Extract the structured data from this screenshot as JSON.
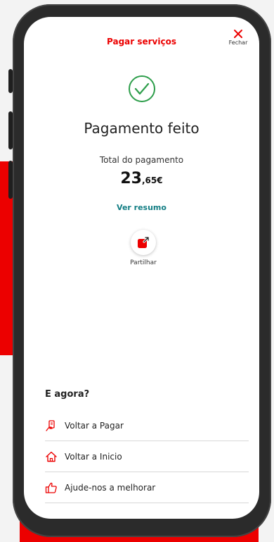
{
  "header": {
    "title": "Pagar serviços",
    "close_label": "Fechar"
  },
  "status": {
    "title": "Pagamento feito",
    "total_label": "Total do pagamento",
    "amount_integer": "23",
    "amount_decimal": ",65€",
    "summary_link": "Ver resumo"
  },
  "share": {
    "label": "Partilhar"
  },
  "next_steps": {
    "heading": "E agora?",
    "items": [
      {
        "label": "Voltar a Pagar",
        "icon": "payment-hand-icon"
      },
      {
        "label": "Voltar a Inicio",
        "icon": "home-icon"
      },
      {
        "label": "Ajude-nos a melhorar",
        "icon": "thumbs-up-icon"
      }
    ]
  },
  "colors": {
    "brand_red": "#ec0000",
    "success_green": "#2e9e4b",
    "link_teal": "#137e84"
  }
}
